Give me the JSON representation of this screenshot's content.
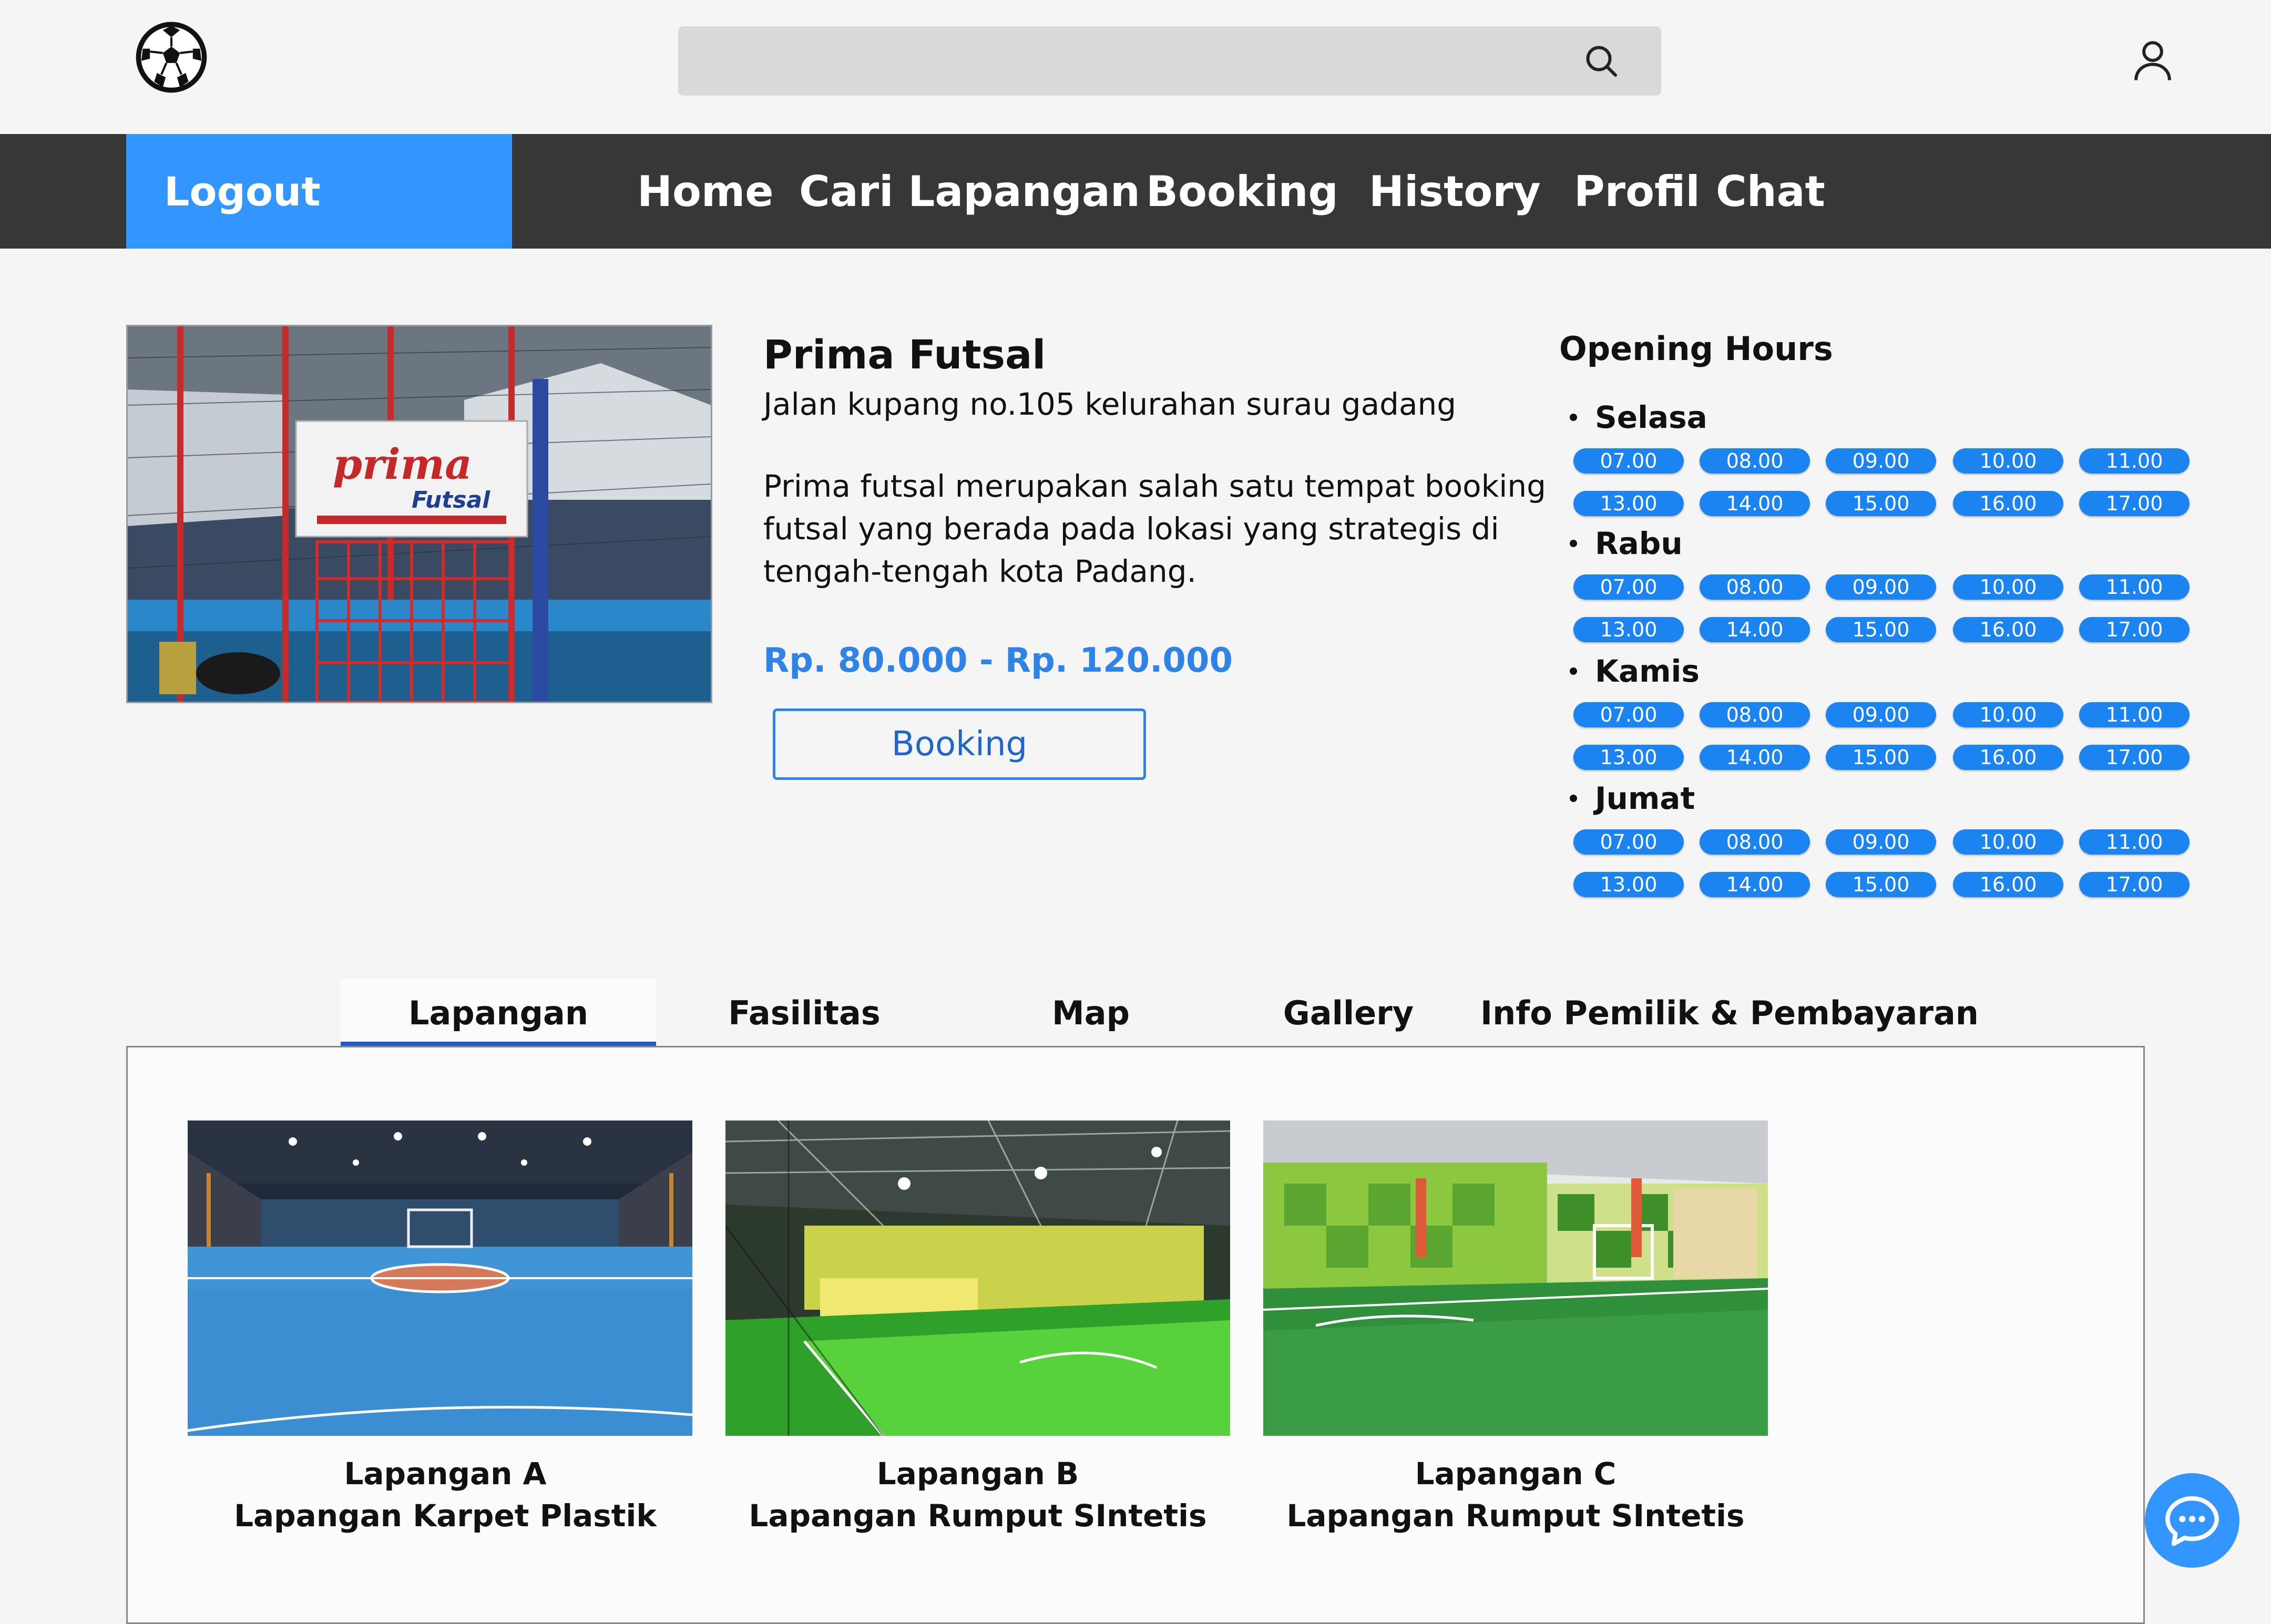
{
  "header": {
    "logo_icon": "soccer-ball-icon",
    "search": {
      "placeholder": "",
      "icon": "search-icon"
    },
    "user_icon": "user-icon"
  },
  "nav": {
    "logout_label": "Logout",
    "items": [
      "Home",
      "Cari Lapangan",
      "Booking",
      "History",
      "Profil",
      "Chat"
    ]
  },
  "venue": {
    "name": "Prima Futsal",
    "address": "Jalan kupang no.105 kelurahan surau gadang",
    "description": "Prima futsal merupakan salah satu tempat booking futsal yang berada pada lokasi yang strategis di tengah-tengah kota Padang.",
    "price": "Rp. 80.000 - Rp. 120.000",
    "booking_label": "Booking",
    "photo_sign_text": "prima",
    "photo_sign_subtext": "Futsal"
  },
  "opening_hours": {
    "title": "Opening Hours",
    "days": [
      {
        "day": "Selasa",
        "slots": [
          "07.00",
          "08.00",
          "09.00",
          "10.00",
          "11.00",
          "13.00",
          "14.00",
          "15.00",
          "16.00",
          "17.00"
        ]
      },
      {
        "day": "Rabu",
        "slots": [
          "07.00",
          "08.00",
          "09.00",
          "10.00",
          "11.00",
          "13.00",
          "14.00",
          "15.00",
          "16.00",
          "17.00"
        ]
      },
      {
        "day": "Kamis",
        "slots": [
          "07.00",
          "08.00",
          "09.00",
          "10.00",
          "11.00",
          "13.00",
          "14.00",
          "15.00",
          "16.00",
          "17.00"
        ]
      },
      {
        "day": "Jumat",
        "slots": [
          "07.00",
          "08.00",
          "09.00",
          "10.00",
          "11.00",
          "13.00",
          "14.00",
          "15.00",
          "16.00",
          "17.00"
        ]
      }
    ]
  },
  "tabs": {
    "items": [
      "Lapangan",
      "Fasilitas",
      "Map",
      "Gallery",
      "Info Pemilik & Pembayaran"
    ],
    "active": "Lapangan"
  },
  "courts": [
    {
      "name": "Lapangan A",
      "type": "Lapangan Karpet Plastik"
    },
    {
      "name": "Lapangan B",
      "type": "Lapangan Rumput SIntetis"
    },
    {
      "name": "Lapangan C",
      "type": "Lapangan Rumput SIntetis"
    }
  ],
  "chat_fab_icon": "chat-bubble-icon",
  "colors": {
    "accent": "#3396ff",
    "slot": "#1c84f0",
    "price": "#2f83e6",
    "navbar": "#373737"
  }
}
